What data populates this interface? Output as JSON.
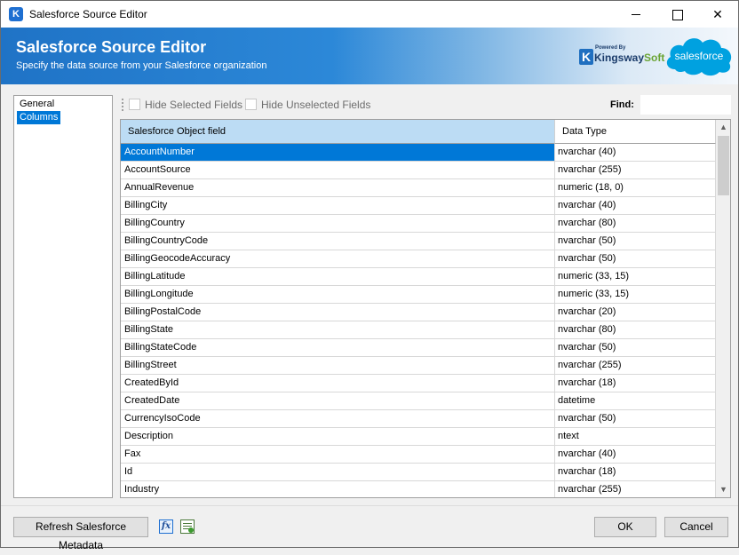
{
  "window": {
    "title": "Salesforce Source Editor",
    "app_icon": "K"
  },
  "banner": {
    "title": "Salesforce Source Editor",
    "subtitle": "Specify the data source from your Salesforce organization",
    "kw_powered": "Powered By",
    "kw_name_a": "Kingsway",
    "kw_name_b": "Soft",
    "sf_logo": "salesforce"
  },
  "nav": {
    "items": [
      {
        "label": "General"
      },
      {
        "label": "Columns"
      }
    ]
  },
  "toolbar": {
    "hide_selected": "Hide Selected Fields",
    "hide_unselected": "Hide Unselected Fields",
    "find_label": "Find:",
    "find_value": ""
  },
  "grid": {
    "columns": [
      "Salesforce Object field",
      "Data Type"
    ],
    "rows": [
      {
        "field": "AccountNumber",
        "type": "nvarchar (40)"
      },
      {
        "field": "AccountSource",
        "type": "nvarchar (255)"
      },
      {
        "field": "AnnualRevenue",
        "type": "numeric (18, 0)"
      },
      {
        "field": "BillingCity",
        "type": "nvarchar (40)"
      },
      {
        "field": "BillingCountry",
        "type": "nvarchar (80)"
      },
      {
        "field": "BillingCountryCode",
        "type": "nvarchar (50)"
      },
      {
        "field": "BillingGeocodeAccuracy",
        "type": "nvarchar (50)"
      },
      {
        "field": "BillingLatitude",
        "type": "numeric (33, 15)"
      },
      {
        "field": "BillingLongitude",
        "type": "numeric (33, 15)"
      },
      {
        "field": "BillingPostalCode",
        "type": "nvarchar (20)"
      },
      {
        "field": "BillingState",
        "type": "nvarchar (80)"
      },
      {
        "field": "BillingStateCode",
        "type": "nvarchar (50)"
      },
      {
        "field": "BillingStreet",
        "type": "nvarchar (255)"
      },
      {
        "field": "CreatedById",
        "type": "nvarchar (18)"
      },
      {
        "field": "CreatedDate",
        "type": "datetime"
      },
      {
        "field": "CurrencyIsoCode",
        "type": "nvarchar (50)"
      },
      {
        "field": "Description",
        "type": "ntext"
      },
      {
        "field": "Fax",
        "type": "nvarchar (40)"
      },
      {
        "field": "Id",
        "type": "nvarchar (18)"
      },
      {
        "field": "Industry",
        "type": "nvarchar (255)"
      }
    ]
  },
  "footer": {
    "refresh_label": "Refresh Salesforce Metadata",
    "fx_icon": "fx",
    "ok_label": "OK",
    "cancel_label": "Cancel"
  }
}
